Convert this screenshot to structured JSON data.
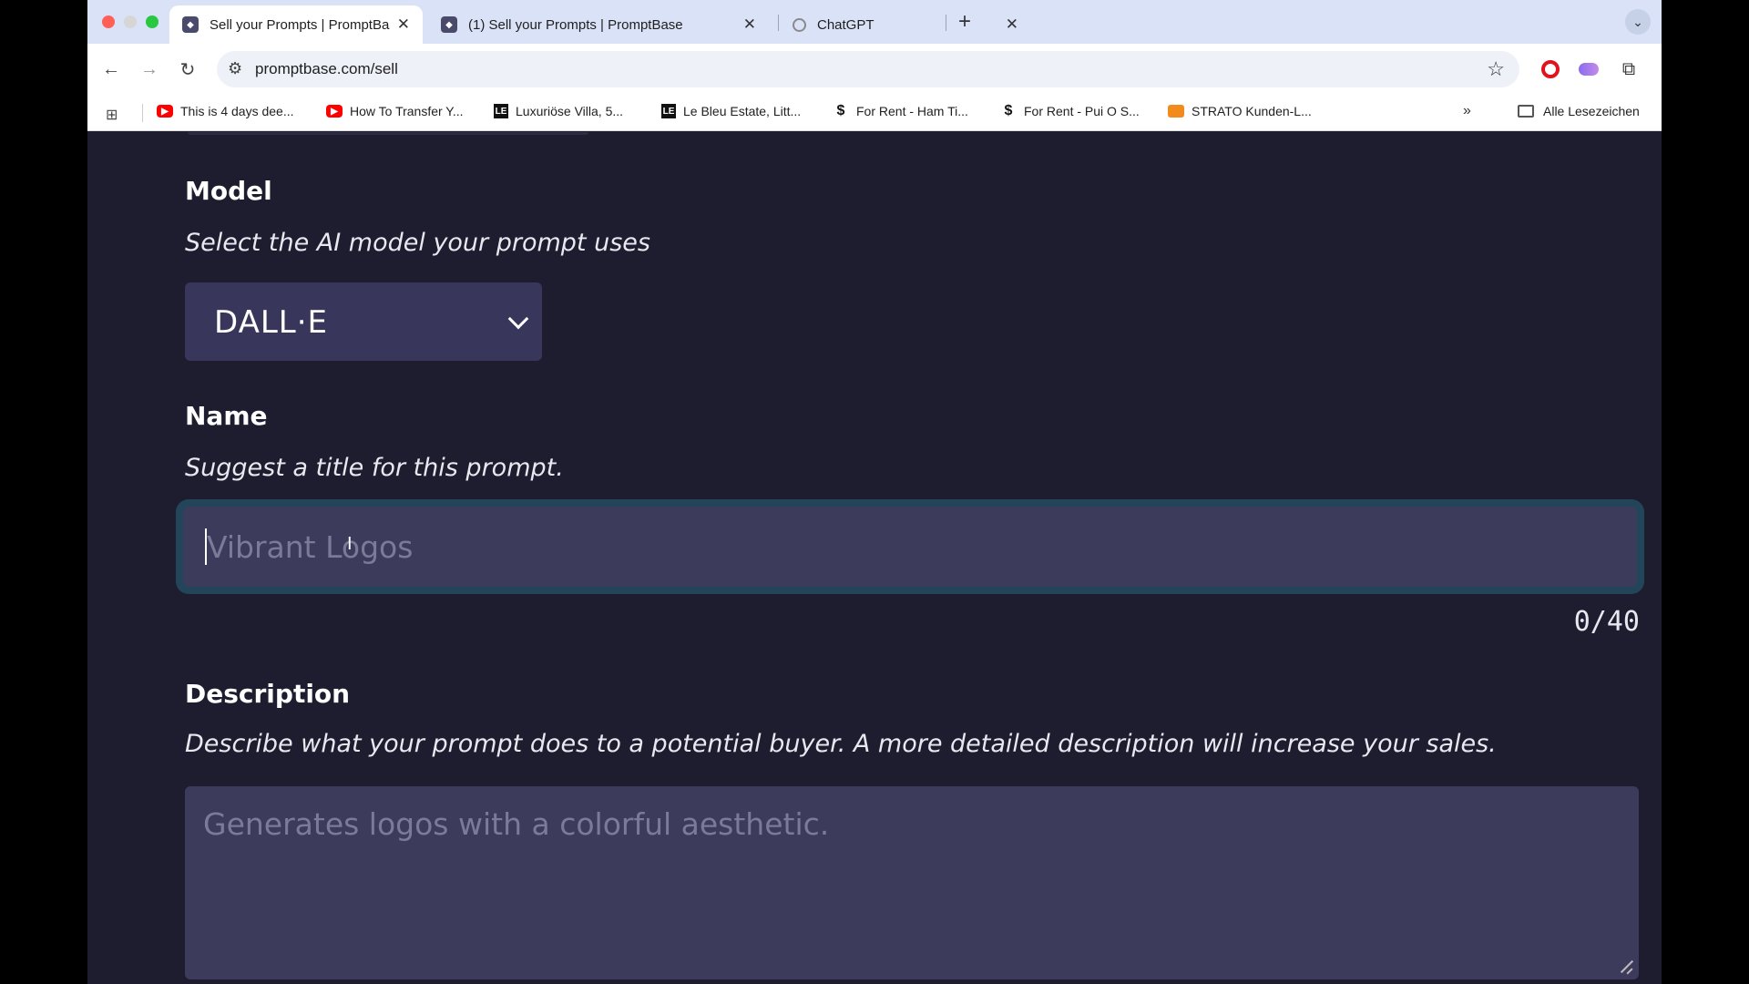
{
  "browser": {
    "tabs": [
      {
        "title": "Sell your Prompts | PromptBase",
        "active": true
      },
      {
        "title": "(1) Sell your Prompts | PromptBase",
        "active": false
      },
      {
        "title": "ChatGPT",
        "active": false
      }
    ],
    "url": "promptbase.com/sell",
    "bookmarks": [
      {
        "label": "This is 4 days dee...",
        "icon": "youtube-icon"
      },
      {
        "label": "How To Transfer Y...",
        "icon": "youtube-icon"
      },
      {
        "label": "Luxuriöse Villa, 5...",
        "icon": "le-icon"
      },
      {
        "label": "Le Bleu Estate, Litt...",
        "icon": "le-icon"
      },
      {
        "label": "For Rent - Ham Ti...",
        "icon": "dollar-icon"
      },
      {
        "label": "For Rent - Pui O S...",
        "icon": "dollar-icon"
      },
      {
        "label": "STRATO Kunden-L...",
        "icon": "strato-icon"
      }
    ],
    "bookmarks_folder": "Alle Lesezeichen"
  },
  "form": {
    "model": {
      "label": "Model",
      "hint": "Select the AI model your prompt uses",
      "selected": "DALL·E"
    },
    "name": {
      "label": "Name",
      "hint": "Suggest a title for this prompt.",
      "placeholder": "Vibrant Logos",
      "value": "",
      "counter": "0/40"
    },
    "description": {
      "label": "Description",
      "hint": "Describe what your prompt does to a potential buyer. A more detailed description will increase your sales.",
      "placeholder": "Generates logos with a colorful aesthetic.",
      "value": ""
    }
  },
  "colors": {
    "page_bg": "#1e1d2f",
    "input_bg": "#3d3b5c",
    "focus_ring": "#23455a"
  }
}
